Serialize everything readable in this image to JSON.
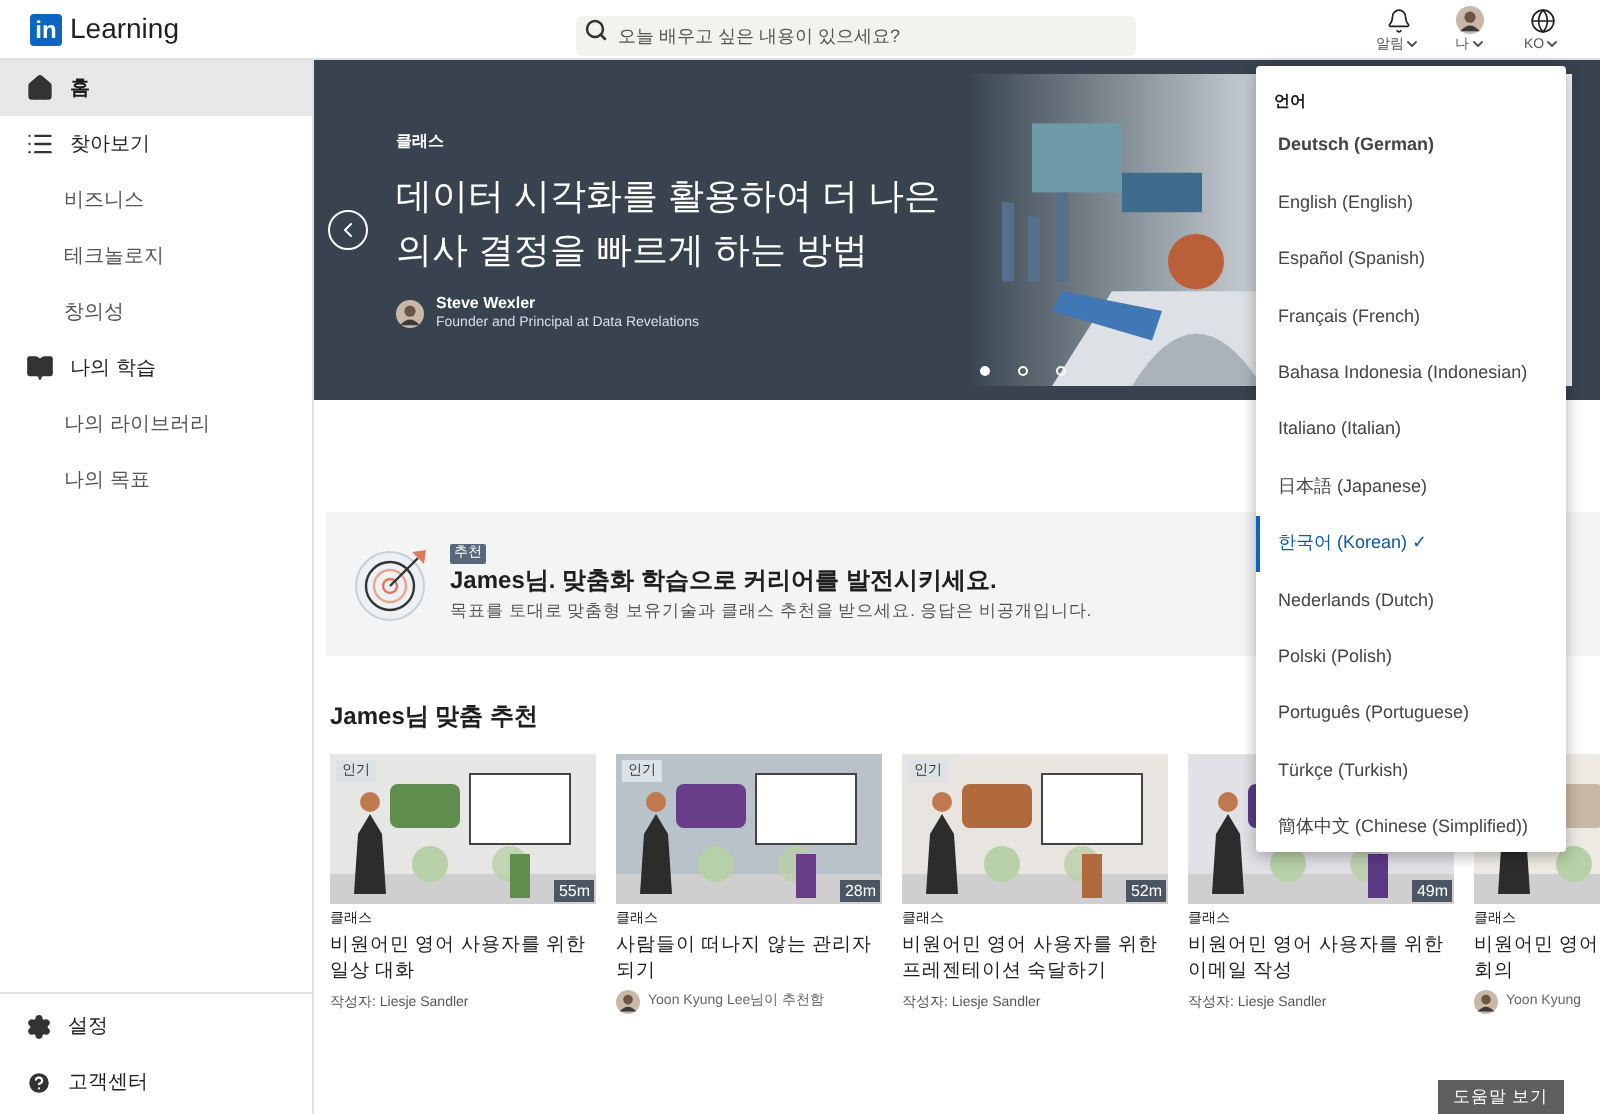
{
  "header": {
    "logo_badge": "in",
    "logo_text": "Learning",
    "search": {
      "placeholder": "오늘 배우고 싶은 내용이 있으세요?"
    },
    "actions": [
      {
        "kind": "bell",
        "label": "알림"
      },
      {
        "kind": "avatar",
        "label": "나"
      },
      {
        "kind": "globe",
        "label": "KO"
      }
    ]
  },
  "sidebar": {
    "items": [
      {
        "label": "홈",
        "selected": true
      },
      {
        "label": "찾아보기",
        "selected": false,
        "children": [
          {
            "label": "비즈니스",
            "selected": false
          },
          {
            "label": "테크놀로지",
            "selected": false
          },
          {
            "label": "창의성",
            "selected": false
          }
        ]
      },
      {
        "label": "나의 학습",
        "selected": false,
        "children": [
          {
            "label": "나의 라이브러리",
            "selected": false
          },
          {
            "label": "나의 목표",
            "selected": false
          }
        ]
      }
    ],
    "footer": [
      {
        "kind": "gear",
        "label": "설정"
      },
      {
        "kind": "help",
        "label": "고객센터"
      }
    ]
  },
  "hero": {
    "eyebrow": "클래스",
    "title": "데이터 시각화를 활용하여 더 나은 의사 결정을 빠르게 하는 방법",
    "author": "Steve Wexler",
    "author_role": "Founder and Principal at Data Revelations",
    "slides": [
      {
        "selected": true
      },
      {
        "selected": false
      },
      {
        "selected": false
      }
    ]
  },
  "promo": {
    "badge": "추천",
    "title": "James님. 맞춤화 학습으로 커리어를 발전시키세요.",
    "text": "목표를 토대로 맞춤형 보유기술과 클래스 추천을 받으세요. 응답은 비공개입니다."
  },
  "recommendations": {
    "title": "James님 맞춤 추천",
    "cards": [
      {
        "badge": "인기",
        "duration": "55m",
        "type": "클래스",
        "title": "비원어민 영어 사용자를 위한 일상 대화",
        "byline": {
          "kind": "author",
          "text": "작성자: Liesje Sandler"
        }
      },
      {
        "badge": "인기",
        "duration": "28m",
        "type": "클래스",
        "title": "사람들이 떠나지 않는 관리자 되기",
        "byline": {
          "kind": "recommender",
          "text": "Yoon Kyung Lee님이 추천함"
        }
      },
      {
        "badge": "인기",
        "duration": "52m",
        "type": "클래스",
        "title": "비원어민 영어 사용자를 위한 프레젠테이션 숙달하기",
        "byline": {
          "kind": "author",
          "text": "작성자: Liesje Sandler"
        }
      },
      {
        "duration": "49m",
        "type": "클래스",
        "title": "비원어민 영어 사용자를 위한 이메일 작성",
        "byline": {
          "kind": "author",
          "text": "작성자: Liesje Sandler"
        }
      },
      {
        "type": "클래스",
        "title": "비원어민 영어\n회의",
        "byline": {
          "kind": "recommender",
          "text": "Yoon Kyung"
        }
      }
    ]
  },
  "help_button": "도움말 보기",
  "language_menu": {
    "title": "언어",
    "check": "✓",
    "items": [
      {
        "label": "Deutsch (German)",
        "selected": false,
        "focused": true
      },
      {
        "label": "English (English)",
        "selected": false,
        "focused": false
      },
      {
        "label": "Español (Spanish)",
        "selected": false,
        "focused": false
      },
      {
        "label": "Français (French)",
        "selected": false,
        "focused": false
      },
      {
        "label": "Bahasa Indonesia (Indonesian)",
        "selected": false,
        "focused": false
      },
      {
        "label": "Italiano (Italian)",
        "selected": false,
        "focused": false
      },
      {
        "label": "日本語 (Japanese)",
        "selected": false,
        "focused": false
      },
      {
        "label": "한국어 (Korean)",
        "selected": true,
        "focused": false
      },
      {
        "label": "Nederlands (Dutch)",
        "selected": false,
        "focused": false
      },
      {
        "label": "Polski (Polish)",
        "selected": false,
        "focused": false
      },
      {
        "label": "Português (Portuguese)",
        "selected": false,
        "focused": false
      },
      {
        "label": "Türkçe (Turkish)",
        "selected": false,
        "focused": false
      },
      {
        "label": "簡体中文 (Chinese (Simplified))",
        "selected": false,
        "focused": false
      }
    ]
  }
}
